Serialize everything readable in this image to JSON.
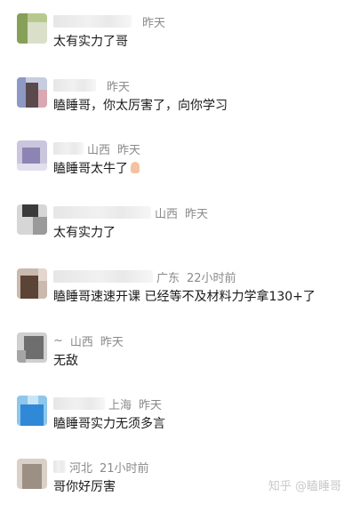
{
  "comments": [
    {
      "location": "",
      "time": "昨天",
      "text": "太有实力了哥"
    },
    {
      "location": "",
      "time": "昨天",
      "text": "瞌睡哥，你太厉害了，向你学习"
    },
    {
      "location": "山西",
      "time": "昨天",
      "text": "瞌睡哥太牛了"
    },
    {
      "location": "山西",
      "time": "昨天",
      "text": "太有实力了"
    },
    {
      "location": "广东",
      "time": "22小时前",
      "text": "瞌睡哥速速开课 已经等不及材料力学拿130+了"
    },
    {
      "location": "山西",
      "time": "昨天",
      "text": "无敌"
    },
    {
      "location": "上海",
      "time": "昨天",
      "text": "瞌睡哥实力无须多言"
    },
    {
      "location": "河北",
      "time": "21小时前",
      "text": "哥你好厉害"
    }
  ],
  "watermark": "知乎 @瞌睡哥",
  "colors": {
    "meta_text": "#8a8a8a",
    "body_text": "#1a1a1a",
    "background": "#ffffff"
  }
}
